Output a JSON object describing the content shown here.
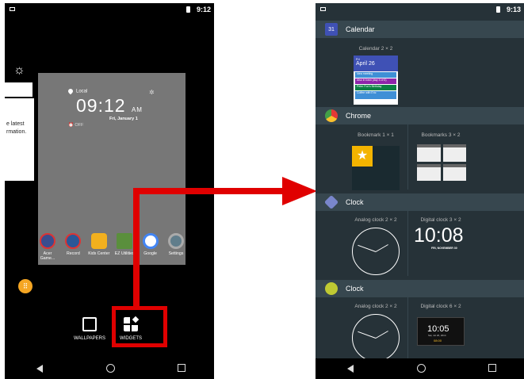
{
  "left": {
    "status_time": "9:12",
    "side_text": [
      "e latest",
      "rmation."
    ],
    "clock": {
      "location": "Local",
      "time": "09:12",
      "ampm": "AM",
      "date": "Fri, January 1",
      "alarm": "OFF"
    },
    "apps": [
      {
        "label": "Acer Game...",
        "color": "#3a4d8f"
      },
      {
        "label": "Record",
        "color": "#2b5797"
      },
      {
        "label": "Kids Center",
        "color": "#f2b01e"
      },
      {
        "label": "EZ Utilities",
        "color": "#5a8f3c"
      },
      {
        "label": "Google",
        "color": "#ffffff"
      },
      {
        "label": "Settings",
        "color": "#607d8b"
      }
    ],
    "options": {
      "wallpapers": "WALLPAPERS",
      "widgets": "WIDGETS"
    }
  },
  "right": {
    "status_time": "9:13",
    "sections": [
      {
        "name": "Calendar",
        "icon": "calendar-icon",
        "icon_text": "31",
        "color": "#3f51b5"
      },
      {
        "name": "Chrome",
        "icon": "chrome-icon",
        "color": "#e53935"
      },
      {
        "name": "Clock",
        "icon": "clock-icon",
        "color": "#5c6bc0"
      },
      {
        "name": "Clock",
        "icon": "clock-alt-icon",
        "color": "#c0ca33"
      }
    ],
    "widgets": {
      "calendar": "Calendar 2 × 2",
      "calendar_day": "Fri",
      "calendar_date": "April 26",
      "calendar_events": [
        "Idea meeting",
        "Also in town (day 4 of 6)",
        "Peter Fox's Birthday",
        "Coffee with Eric"
      ],
      "bookmark1": "Bookmark 1 × 1",
      "bookmarks3": "Bookmarks 3 × 2",
      "analog1": "Analog clock 2 × 2",
      "digital3": "Digital clock 3 × 2",
      "digital_time": "10:08",
      "digital_date": "FRI, NOVEMBER 30",
      "analog2": "Analog clock 2 × 2",
      "digital6": "Digital clock 6 × 2",
      "digital6_time": "10:05",
      "digital6_date": "Sat, Jul 26, 2014",
      "digital6_alarm": "08:00"
    }
  },
  "accent": {
    "highlight": "#e00000"
  }
}
